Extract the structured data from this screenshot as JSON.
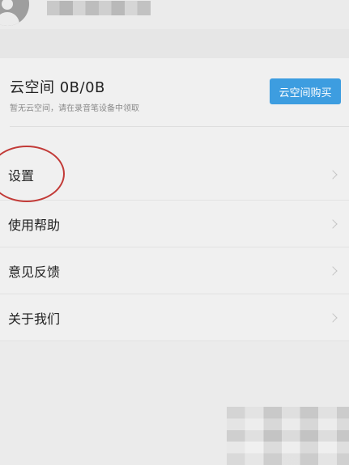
{
  "profile": {
    "avatar_icon": "user-avatar-icon"
  },
  "cloud": {
    "title": "云空间  0B/0B",
    "subtitle": "暂无云空间，请在录音笔设备中领取",
    "buy_button": "云空间购买"
  },
  "menu": {
    "items": [
      {
        "label": "设置"
      },
      {
        "label": "使用帮助"
      },
      {
        "label": "意见反馈"
      },
      {
        "label": "关于我们"
      }
    ],
    "chevron_icon": "chevron-right-icon"
  },
  "colors": {
    "accent": "#3d9de0",
    "highlight_ring": "#c23a37",
    "background": "#ebebeb"
  }
}
